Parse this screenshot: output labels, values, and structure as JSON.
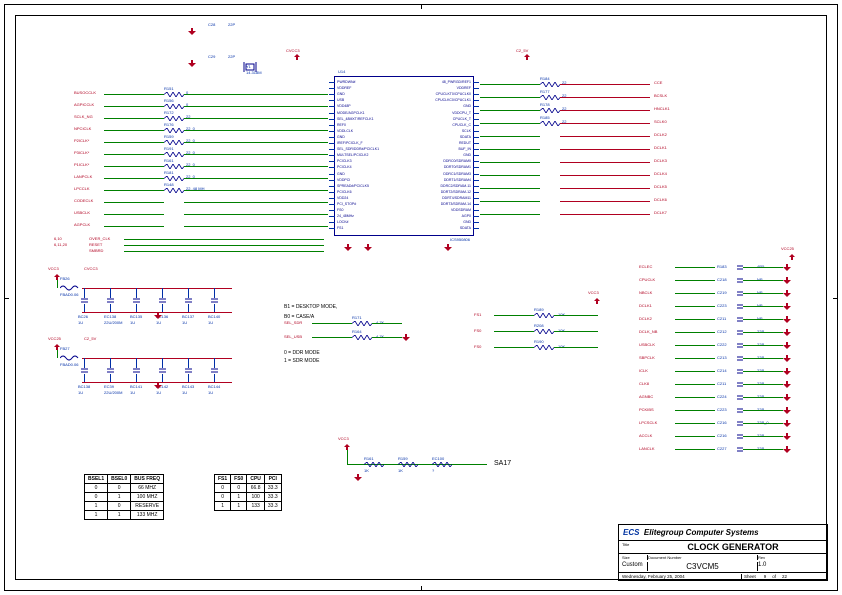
{
  "title_block": {
    "company": "Elitegroup Computer Systems",
    "title": "CLOCK GENERATOR",
    "docnum_label": "Document Number",
    "docnum": "C3VCM5",
    "rev_label": "Rev",
    "rev": "1.0",
    "size_label": "Size",
    "size": "Custom",
    "date": "Wednesday, February 25, 2004",
    "sheet_label": "Sheet",
    "sheet": "9",
    "of": "of",
    "total": "22"
  },
  "tables": {
    "freq": {
      "headers": [
        "BSEL1",
        "BSEL0",
        "BUS FREQ"
      ],
      "rows": [
        [
          "0",
          "0",
          "66 MHZ"
        ],
        [
          "0",
          "1",
          "100 MHZ"
        ],
        [
          "1",
          "0",
          "RESERVE"
        ],
        [
          "1",
          "1",
          "133 MHZ"
        ]
      ]
    },
    "div": {
      "headers": [
        "FS1",
        "FS0",
        "CPU",
        "PCI"
      ],
      "rows": [
        [
          "0",
          "0",
          "66.8",
          "33.3"
        ],
        [
          "0",
          "1",
          "100",
          "33.3"
        ],
        [
          "1",
          "1",
          "133",
          "33.3"
        ]
      ]
    }
  },
  "ic": {
    "ref": "U14",
    "part": "ICS950806",
    "left_pins": [
      "PWRDWN#",
      "VDDREF",
      "GND",
      "USB",
      "VDD48P",
      "MODE/AGPCLK1",
      "SEL_48MXT/REFCLK1",
      "REF0",
      "VDDLCLK",
      "GND",
      "IREF/PCICLK_F",
      "SEL_SDR/DDR#/PCICLK1",
      "MULTSEL/PCICLK2",
      "PCICLK3",
      "PCICLK4",
      "GND",
      "VDDPCI",
      "SPREAD#/PCICLK5",
      "PCICLK6",
      "VDD24",
      "PCI_STOP#",
      "FS0",
      "24_48MHz",
      "LOCK#",
      "FS1"
    ],
    "right_pins": [
      "48_PWRGD/REF1",
      "VDDREF",
      "CPUCLKT0/CPUCLK0",
      "CPUCLKC0/CPUCLK1",
      "GND",
      "VDDCPU_T",
      "CPUCLK_T",
      "CPUCLK_C",
      "SCLK",
      "SDATA",
      "REDUT",
      "BUF_IN",
      "GND",
      "DDRC0/SDRAM0",
      "DDRT0/SDRAM1",
      "DDRC1/SDRAM3",
      "DDRT1/SDRAM4",
      "DDRC2/SDRAM-11",
      "DDRT2/SDRAM-12",
      "DDRT4/SDRAM11",
      "DDRT3/SDRAM-14",
      "VDDSDRAM",
      "AGP0",
      "GND",
      "SDATA"
    ]
  },
  "left_nets": [
    {
      "net": "BUSOCCLK",
      "ref": "R151",
      "val": "0"
    },
    {
      "net": "AGPICCLK",
      "ref": "R156",
      "val": "0"
    },
    {
      "net": "SCLK_NG",
      "ref": "R172",
      "val": "22"
    },
    {
      "net": "NPCICLK",
      "ref": "R176",
      "val": "22_0"
    },
    {
      "net": "P2ICLK*",
      "ref": "R159",
      "val": "22_0"
    },
    {
      "net": "P3ICLK*",
      "ref": "R191",
      "val": "22_0"
    },
    {
      "net": "P1ICLK*",
      "ref": "R161",
      "val": "22_0"
    },
    {
      "net": "LANPCLK",
      "ref": "R181",
      "val": "22_0"
    },
    {
      "net": "LPCCLK",
      "ref": "R148",
      "val": "22, 48 MH"
    },
    {
      "net": "CODECLK",
      "ref": "",
      "val": ""
    },
    {
      "net": "USBCLK",
      "ref": "",
      "val": ""
    },
    {
      "net": "AGPCLK",
      "ref": "",
      "val": ""
    }
  ],
  "right_nets": [
    {
      "net": "HCLK",
      "ref": "R184",
      "val": "22",
      "net2": "CCE"
    },
    {
      "net": "BCSLK",
      "ref": "R177",
      "val": "22",
      "net2": "BCSLK"
    },
    {
      "net": "NBHCLK",
      "ref": "R178",
      "val": "22",
      "net2": "HNCLK1"
    },
    {
      "net": "SCLK0",
      "ref": "R185",
      "val": "22",
      "net2": "SCLK0"
    },
    {
      "net": "DCLK2",
      "ref": "",
      "val": "",
      "net2": "DCLK2"
    },
    {
      "net": "DCLK1",
      "ref": "",
      "val": "",
      "net2": "DCLK1"
    },
    {
      "net": "DCLK3",
      "ref": "",
      "val": "",
      "net2": "DCLK3"
    },
    {
      "net": "DCLK4",
      "ref": "",
      "val": "",
      "net2": "DCLK4"
    },
    {
      "net": "DCLK5",
      "ref": "",
      "val": "",
      "net2": "DCLK5"
    },
    {
      "net": "DCLK6",
      "ref": "",
      "val": "",
      "net2": "DCLK6"
    },
    {
      "net": "DCLK7",
      "ref": "",
      "val": "",
      "net2": "DCLK7"
    }
  ],
  "bottom_left": [
    {
      "net": "OVER_CLK",
      "page": "6,10"
    },
    {
      "net": "RESET",
      "page": "6,11,20"
    },
    {
      "net": "SMBRD",
      "page": ""
    }
  ],
  "decoup1": {
    "vcc": "VCC3",
    "cvcc": "CVCC3",
    "fb": {
      "ref": "FB26",
      "val": "FBAD0.06"
    },
    "caps": [
      {
        "ref": "BC26",
        "val": "1U"
      },
      {
        "ref": "EC138",
        "val": "22U/200M"
      },
      {
        "ref": "BC135",
        "val": "1U"
      },
      {
        "ref": "BC136",
        "val": "1U"
      },
      {
        "ref": "BC137",
        "val": "1U"
      },
      {
        "ref": "BC140",
        "val": "1U"
      }
    ]
  },
  "decoup2": {
    "vcc": "VCC25",
    "cvcc": "C2_5V",
    "fb": {
      "ref": "FB27",
      "val": "FBAD0.06"
    },
    "caps": [
      {
        "ref": "BC138",
        "val": "1U"
      },
      {
        "ref": "EC39",
        "val": "22U/200M"
      },
      {
        "ref": "BC141",
        "val": "1U"
      },
      {
        "ref": "BC142",
        "val": "1U"
      },
      {
        "ref": "BC143",
        "val": "1U"
      },
      {
        "ref": "BC144",
        "val": "1U"
      }
    ]
  },
  "mode_block": {
    "notes": [
      "B1 = DESKTOP MODE,",
      "B0 = CASE/A",
      "0 = DDR MODE",
      "1 = SDR MODE"
    ],
    "rows": [
      {
        "net": "SEL_SDR",
        "ref": "R171",
        "val": "4.7K"
      },
      {
        "net": "SEL_USB",
        "ref": "R164",
        "val": "4.7K"
      }
    ]
  },
  "fs_block": {
    "vcc": "VCC3",
    "rows": [
      {
        "net": "FS1",
        "ref": "R189",
        "val": "10K"
      },
      {
        "net": "FS0",
        "ref": "R208",
        "val": "10K"
      },
      {
        "net": "FS0",
        "ref": "R190",
        "val": "10K"
      }
    ]
  },
  "sa17_block": {
    "vcc": "VCC3",
    "net": "SA17",
    "parts": [
      {
        "ref": "R161",
        "val": "1K"
      },
      {
        "ref": "R159",
        "val": "1K"
      },
      {
        "ref": "EC100",
        "val": "?"
      }
    ]
  },
  "right_caps": {
    "vcc": "VCC25",
    "rows": [
      {
        "net": "ECLEC",
        "ref": "R183",
        "val": "4R5"
      },
      {
        "net": "CPUCLK",
        "ref": "C218",
        "val": "NP"
      },
      {
        "net": "NBCLK",
        "ref": "C219",
        "val": "NP"
      },
      {
        "net": "DCLK1",
        "ref": "C223",
        "val": "NP"
      },
      {
        "net": "DCLK2",
        "ref": "C211",
        "val": "NP"
      },
      {
        "net": "DCLK_NB",
        "ref": "C212",
        "val": "22P"
      },
      {
        "net": "USBCLK",
        "ref": "C222",
        "val": "22P"
      },
      {
        "net": "SBPCLK",
        "ref": "C213",
        "val": "22P"
      },
      {
        "net": "ICLK",
        "ref": "C214",
        "val": "22P"
      },
      {
        "net": "CLK8",
        "ref": "C211",
        "val": "22P"
      },
      {
        "net": "AGNBC",
        "ref": "C224",
        "val": "22P"
      },
      {
        "net": "PCKIBS",
        "ref": "C223",
        "val": "22P"
      },
      {
        "net": "LPCSCLK",
        "ref": "C216",
        "val": "22P_0"
      },
      {
        "net": "ACCLK",
        "ref": "C216",
        "val": "22P"
      },
      {
        "net": "LANCLK",
        "ref": "C227",
        "val": "22P"
      }
    ]
  },
  "xtal": {
    "ref": "Y1",
    "val": "14.318M"
  },
  "caps_top": [
    {
      "ref": "C28",
      "val": "22P"
    },
    {
      "ref": "C29",
      "val": "22P"
    }
  ],
  "misc_res": [
    {
      "ref": "R167",
      "val": "22_0"
    },
    {
      "ref": "R168",
      "val": "22, 48 MH"
    },
    {
      "ref": "R169",
      "val": "CLKPUR 1K1"
    }
  ],
  "chart_data": {
    "type": "table",
    "title": "BUS FREQ selection",
    "series": [
      {
        "name": "freq",
        "categories": [
          "BSEL1",
          "BSEL0"
        ],
        "rows": [
          [
            0,
            0,
            "66 MHZ"
          ],
          [
            0,
            1,
            "100 MHZ"
          ],
          [
            1,
            0,
            "RESERVE"
          ],
          [
            1,
            1,
            "133 MHZ"
          ]
        ]
      },
      {
        "name": "div",
        "categories": [
          "FS1",
          "FS0",
          "CPU",
          "PCI"
        ],
        "rows": [
          [
            0,
            0,
            66.8,
            33.3
          ],
          [
            0,
            1,
            100,
            33.3
          ],
          [
            1,
            1,
            133,
            33.3
          ]
        ]
      }
    ]
  }
}
